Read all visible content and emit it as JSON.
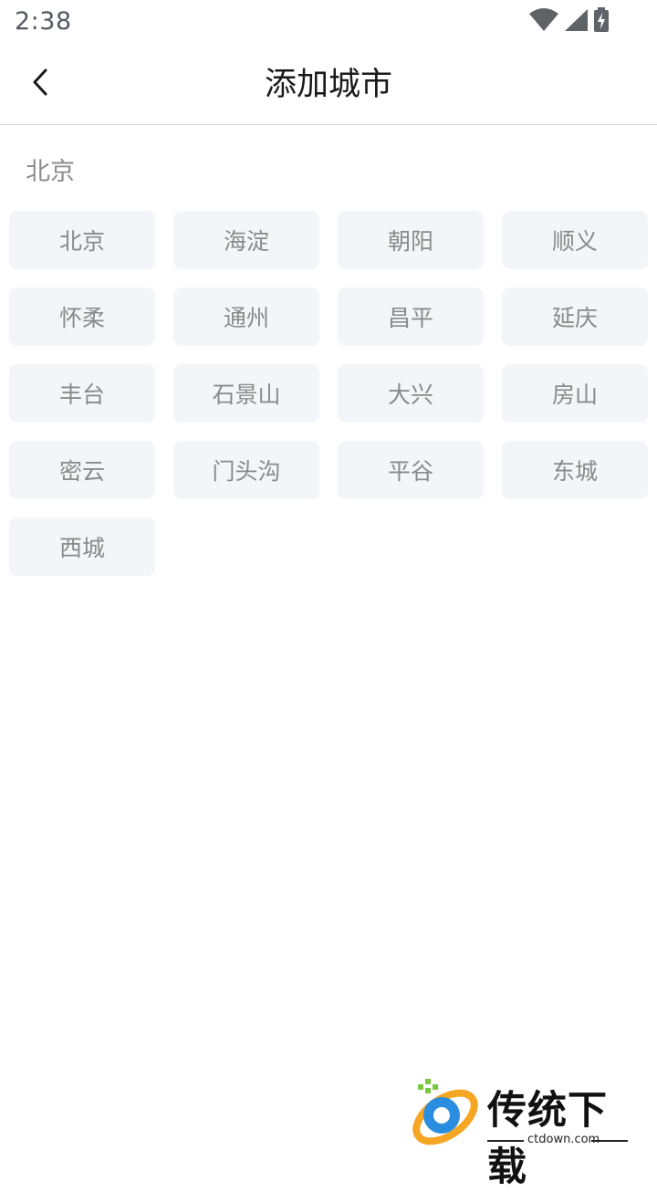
{
  "status_bar": {
    "time": "2:38",
    "icons": [
      "wifi-icon",
      "signal-icon",
      "battery-charging-icon"
    ]
  },
  "header": {
    "back_icon": "chevron-left-icon",
    "title": "添加城市"
  },
  "section": {
    "title": "北京",
    "cities": [
      "北京",
      "海淀",
      "朝阳",
      "顺义",
      "怀柔",
      "通州",
      "昌平",
      "延庆",
      "丰台",
      "石景山",
      "大兴",
      "房山",
      "密云",
      "门头沟",
      "平谷",
      "东城",
      "西城"
    ]
  },
  "watermark": {
    "name": "传统下载",
    "url": "ctdown.com"
  }
}
